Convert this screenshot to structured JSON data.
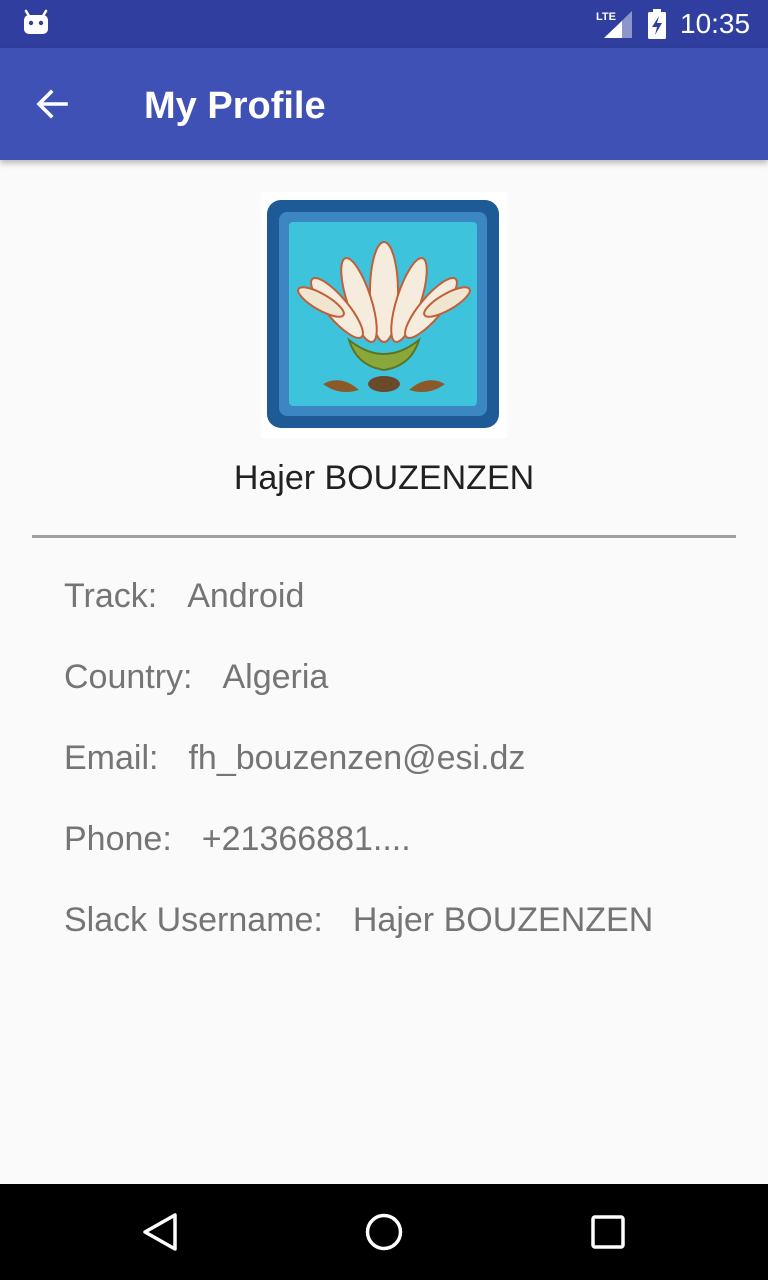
{
  "status_bar": {
    "time": "10:35",
    "network": "LTE",
    "icons": [
      "android-icon",
      "lte-signal-icon",
      "battery-charging-icon"
    ]
  },
  "app_bar": {
    "title": "My Profile",
    "back_icon": "arrow-back-icon"
  },
  "profile": {
    "avatar_icon": "lotus-tile-avatar",
    "name": "Hajer BOUZENZEN",
    "fields": {
      "track": {
        "label": "Track:",
        "value": "Android"
      },
      "country": {
        "label": "Country:",
        "value": "Algeria"
      },
      "email": {
        "label": "Email:",
        "value": "fh_bouzenzen@esi.dz"
      },
      "phone": {
        "label": "Phone:",
        "value": "+21366881...."
      },
      "slack": {
        "label": "Slack Username:",
        "value": "Hajer BOUZENZEN"
      }
    }
  },
  "nav_bar": {
    "buttons": [
      "nav-back-icon",
      "nav-home-icon",
      "nav-recents-icon"
    ]
  },
  "colors": {
    "status_bar": "#303f9f",
    "app_bar": "#3f51b5",
    "background": "#fafafa",
    "label_text": "#757575",
    "name_text": "#212121",
    "divider": "#a0a0a0"
  }
}
